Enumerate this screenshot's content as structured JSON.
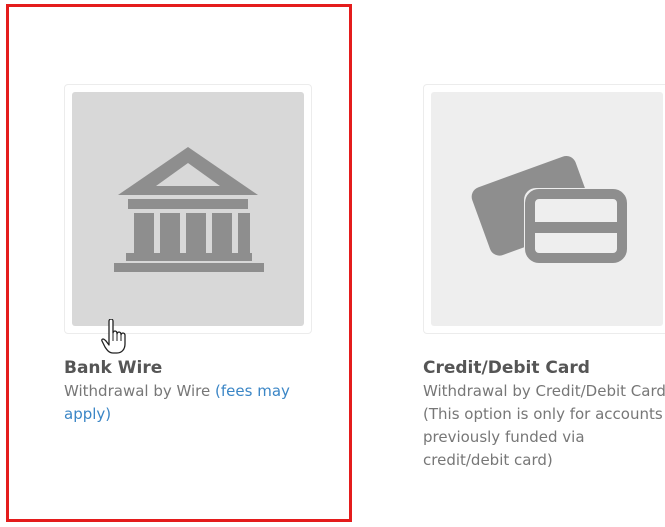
{
  "options": [
    {
      "title": "Bank Wire",
      "description": "Withdrawal by Wire",
      "link_text": "(fees may apply)",
      "icon": "bank-icon",
      "selected": true
    },
    {
      "title": "Credit/Debit Card",
      "description": "Withdrawal by Credit/Debit Card (This option is only for accounts previously funded via credit/debit card)",
      "icon": "credit-card-icon",
      "selected": false
    }
  ],
  "colors": {
    "highlight": "#e41c1c",
    "link": "#3b86c6",
    "title": "#555555",
    "text": "#777777",
    "icon": "#8e8e8e"
  },
  "cursor": "hand-pointer-icon"
}
